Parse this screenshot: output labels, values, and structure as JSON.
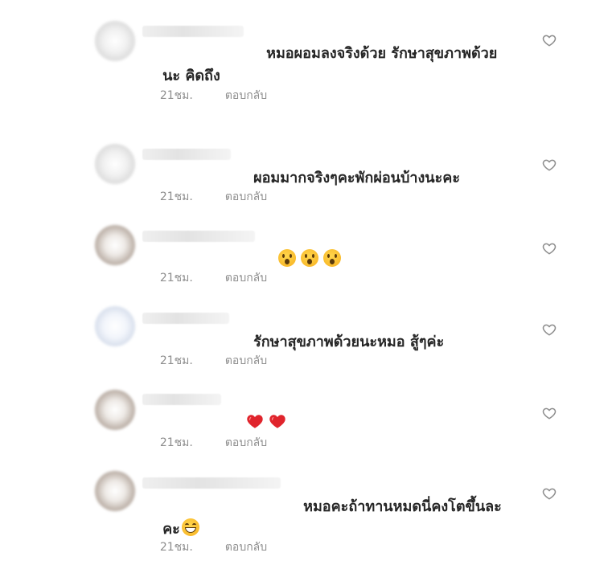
{
  "comments": [
    {
      "text_line1": "หมอผอมลงจริงด้วย รักษาสุขภาพด้วย",
      "text_line2": "นะ คิดถึง",
      "emojis": [],
      "time": "21ชม.",
      "reply_label": "ตอบกลับ",
      "avatar_style": "light"
    },
    {
      "text_line1": "ผอมมากจริงๆคะพักผ่อนบ้างนะคะ",
      "text_line2": "",
      "emojis": [],
      "time": "21ชม.",
      "reply_label": "ตอบกลับ",
      "avatar_style": "light"
    },
    {
      "text_line1": "",
      "text_line2": "",
      "emojis": [
        "astonished-face",
        "astonished-face",
        "astonished-face"
      ],
      "time": "21ชม.",
      "reply_label": "ตอบกลับ",
      "avatar_style": "dark"
    },
    {
      "text_line1": "รักษาสุขภาพด้วยนะหมอ สู้ๆค่ะ",
      "text_line2": "",
      "emojis": [],
      "time": "21ชม.",
      "reply_label": "ตอบกลับ",
      "avatar_style": "blue"
    },
    {
      "text_line1": "",
      "text_line2": "",
      "emojis": [
        "red-heart",
        "red-heart"
      ],
      "time": "21ชม.",
      "reply_label": "ตอบกลับ",
      "avatar_style": "dark"
    },
    {
      "text_line1": "หมอคะถ้าทานหมดนี่คงโตขึ้นละ",
      "text_line2": "คะ",
      "emojis": [
        "grinning-face"
      ],
      "time": "21ชม.",
      "reply_label": "ตอบกลับ",
      "avatar_style": "dark"
    }
  ],
  "icons": {
    "like": "heart-outline-icon"
  },
  "colors": {
    "text": "#262626",
    "meta": "#8e8e8e",
    "heart_outline": "#8e8e8e",
    "emoji_heart": "#e0242c"
  }
}
